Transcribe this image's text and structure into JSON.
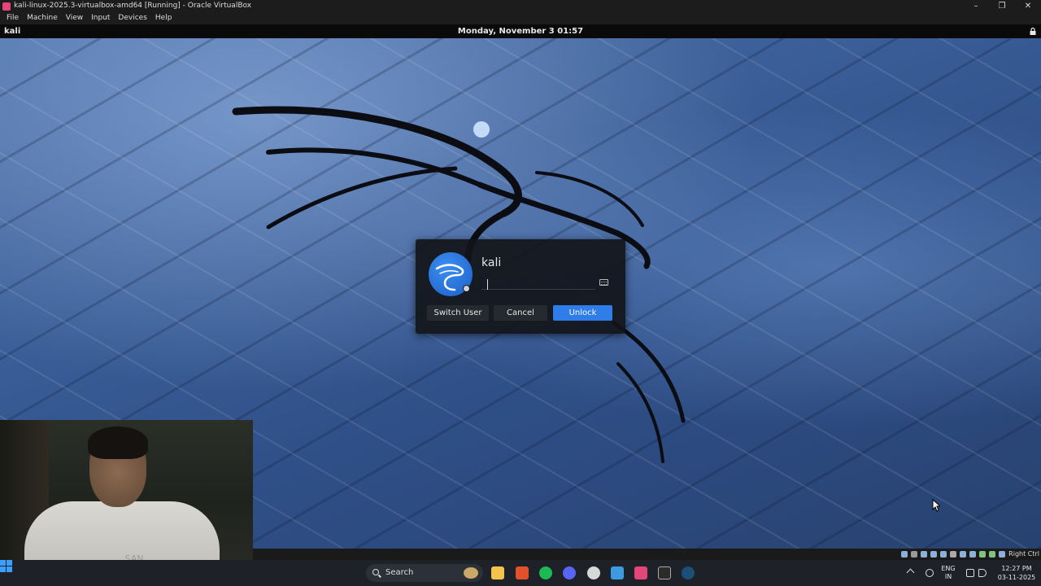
{
  "window": {
    "title": "kali-linux-2025.3-virtualbox-amd64 [Running] - Oracle VirtualBox",
    "controls": [
      "minimize",
      "restore",
      "close"
    ]
  },
  "menu": {
    "items": [
      "File",
      "Machine",
      "View",
      "Input",
      "Devices",
      "Help"
    ]
  },
  "kali_panel": {
    "hostname": "kali",
    "datetime": "Monday, November  3  01:57",
    "lock_icon": "lock-icon"
  },
  "lock_dialog": {
    "username": "kali",
    "password_value": "",
    "keyboard_icon": "keyboard-icon",
    "buttons": {
      "switch_user": "Switch User",
      "cancel": "Cancel",
      "unlock": "Unlock"
    },
    "accent_color": "#2e7de8"
  },
  "webcam": {
    "shirt_text": "SAN FRANCISCO"
  },
  "vbox_status": {
    "host_key": "Right Ctrl"
  },
  "taskbar": {
    "search_placeholder": "Search",
    "language_line1": "ENG",
    "language_line2": "IN",
    "time": "12:27 PM",
    "date": "03-11-2025",
    "pinned_apps": [
      "file-explorer-icon",
      "brave-icon",
      "spotify-icon",
      "discord-icon",
      "chatgpt-icon",
      "vscode-icon",
      "virtualbox-icon",
      "epic-games-icon",
      "steam-icon"
    ]
  }
}
